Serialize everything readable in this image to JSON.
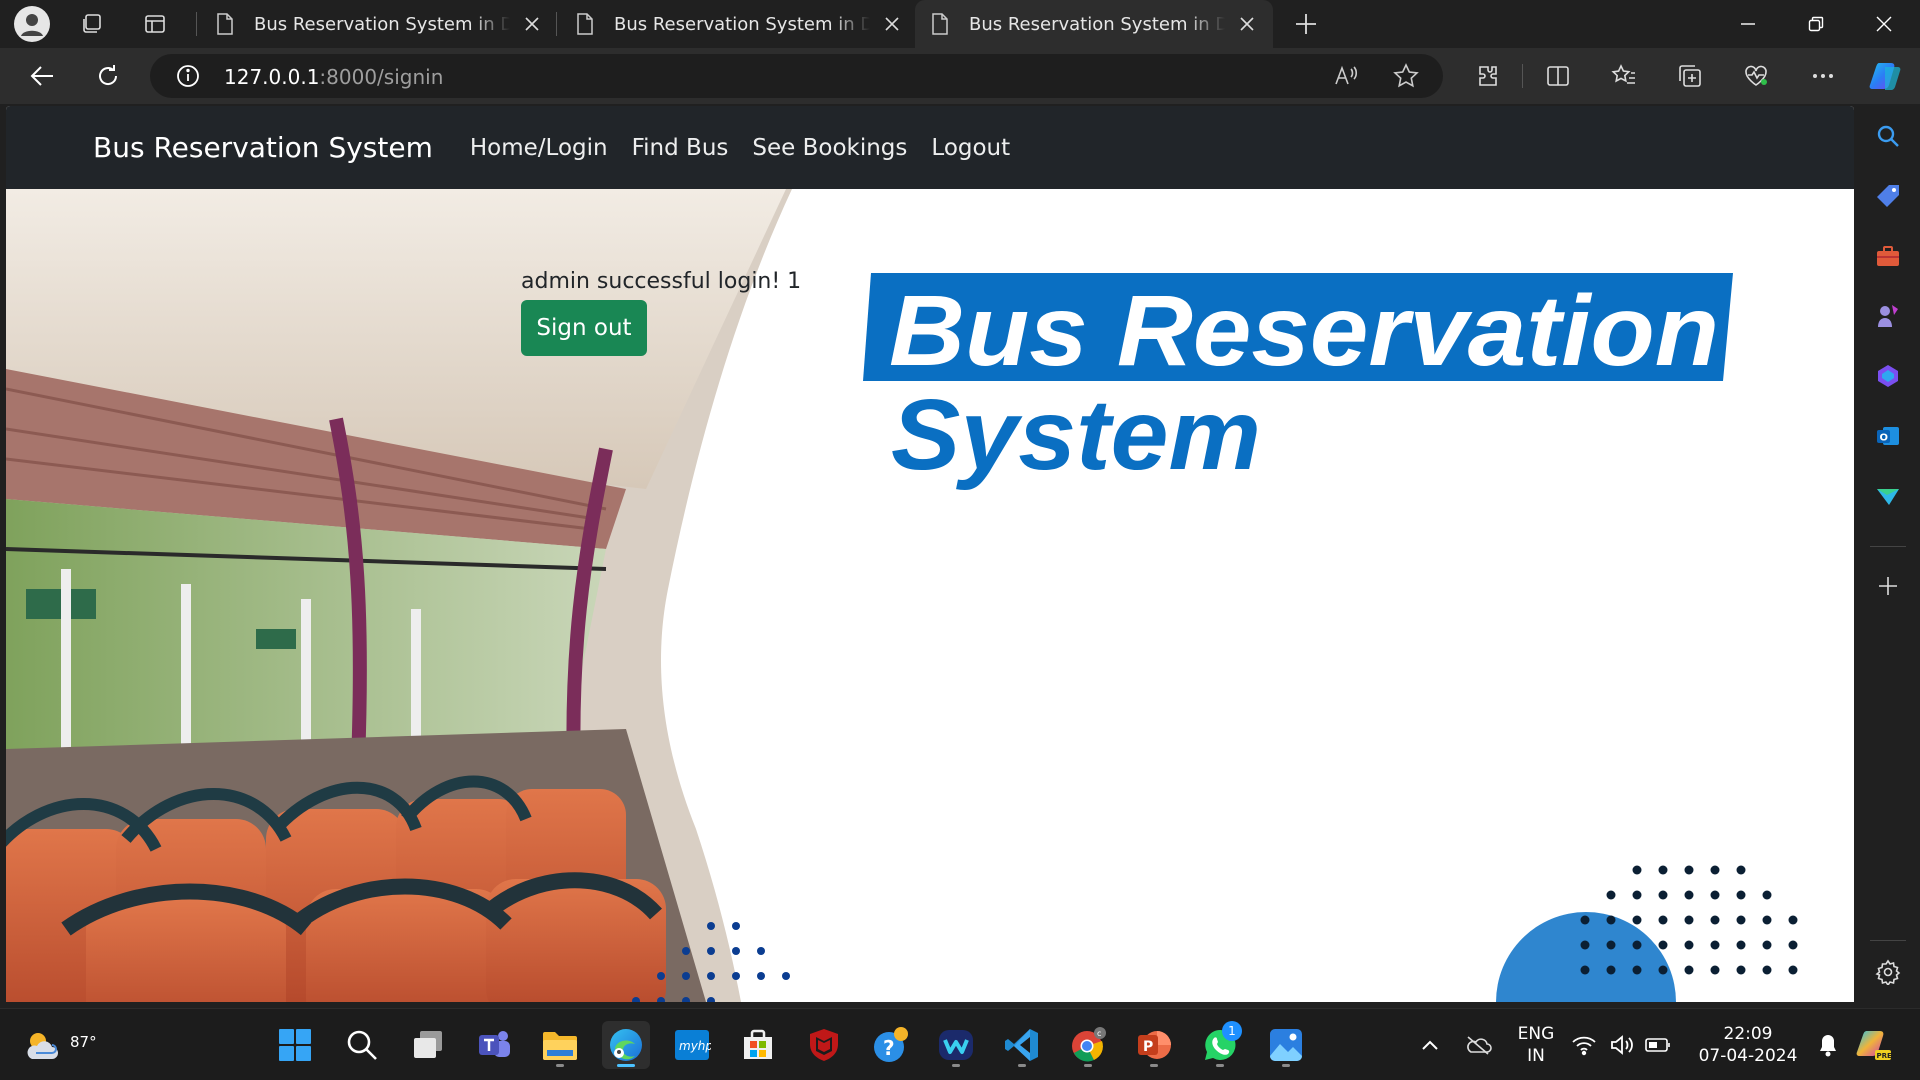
{
  "browser": {
    "tabs": [
      {
        "title": "Bus Reservation System in Django",
        "active": false
      },
      {
        "title": "Bus Reservation System in Django",
        "active": false
      },
      {
        "title": "Bus Reservation System in Django",
        "active": true
      }
    ],
    "address": {
      "host": "127.0.0.1",
      "path": ":8000/signin"
    },
    "toolbar_icons": [
      "back-icon",
      "refresh-icon",
      "site-info-icon",
      "read-aloud-icon",
      "favorite-star-icon",
      "extensions-icon",
      "split-screen-icon",
      "favorites-icon",
      "collections-icon",
      "browser-essentials-icon",
      "more-icon",
      "copilot-icon"
    ],
    "sidebar_icons": [
      "search-icon",
      "shopping-icon",
      "tools-icon",
      "games-icon",
      "microsoft-365-icon",
      "outlook-icon",
      "drop-icon",
      "add-icon",
      "settings-icon"
    ]
  },
  "page": {
    "navbar": {
      "brand": "Bus Reservation System",
      "links": [
        "Home/Login",
        "Find Bus",
        "See Bookings",
        "Logout"
      ]
    },
    "message": "admin successful login! 1",
    "signout_label": "Sign out",
    "logo": {
      "line1": "Bus Reservation",
      "line2": "System",
      "color": "#0a6fc2"
    },
    "colors": {
      "navbar": "#212529",
      "signout": "#198754",
      "dots": "#0b3d91"
    }
  },
  "taskbar": {
    "weather": "87°",
    "apps": [
      "start-icon",
      "search-icon",
      "task-view-icon",
      "teams-icon",
      "file-explorer-icon",
      "edge-icon",
      "myhp-icon",
      "microsoft-store-icon",
      "mcafee-icon",
      "help-icon",
      "webex-icon",
      "vscode-icon",
      "chrome-icon",
      "powerpoint-icon",
      "whatsapp-icon",
      "photos-icon"
    ],
    "whatsapp_badge": "1",
    "myhp_label": "myhp",
    "language": {
      "line1": "ENG",
      "line2": "IN"
    },
    "clock": {
      "time": "22:09",
      "date": "07-04-2024"
    }
  }
}
